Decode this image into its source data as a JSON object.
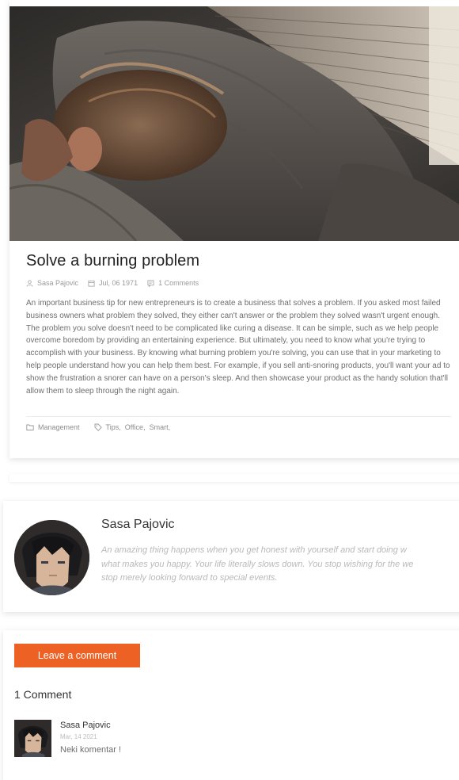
{
  "post": {
    "title": "Solve a burning problem",
    "image_icon": "photo-sleeping-person",
    "meta": {
      "author": "Sasa Pajovic",
      "date": "Jul, 06 1971",
      "comments": "1 Comments"
    },
    "body": "An important business tip for new entrepreneurs is to create a business that solves a problem. If you asked most failed business owners what problem they solved, they either can't answer or the problem they solved wasn't urgent enough. The problem you solve doesn't need to be complicated like curing a disease. It can be simple, such as we help people overcome boredom by providing an entertaining experience. But ultimately, you need to know what you're trying to accomplish with your business. By knowing what burning problem you're solving, you can use that in your marketing to help people understand how you can help them best. For example, if you sell anti-snoring products, you'll want your ad to show the frustration a snorer can have on a person's sleep. And then showcase your product as the handy solution that'll allow them to sleep through the night again.",
    "category": "Management",
    "tags": [
      "Tips,",
      "Office,",
      "Smart,"
    ]
  },
  "author_box": {
    "name": "Sasa Pajovic",
    "bio_lines": [
      "An amazing thing happens when you get honest with yourself and start doing w",
      "what makes you happy. Your life literally slows down. You stop wishing for the we",
      "stop merely looking forward to special events."
    ]
  },
  "comments": {
    "leave_label": "Leave a comment",
    "count_label": "1 Comment",
    "items": [
      {
        "author": "Sasa Pajovic",
        "date": "Mar, 14 2021",
        "text": "Neki komentar !"
      }
    ]
  },
  "colors": {
    "accent": "#ee6124",
    "meta_text": "#9a9a9a",
    "bio_text": "#b9b9b9"
  },
  "icons": {
    "author": "user-icon",
    "date": "calendar-icon",
    "comments": "comment-icon",
    "category": "folder-icon",
    "tags": "tag-icon"
  }
}
